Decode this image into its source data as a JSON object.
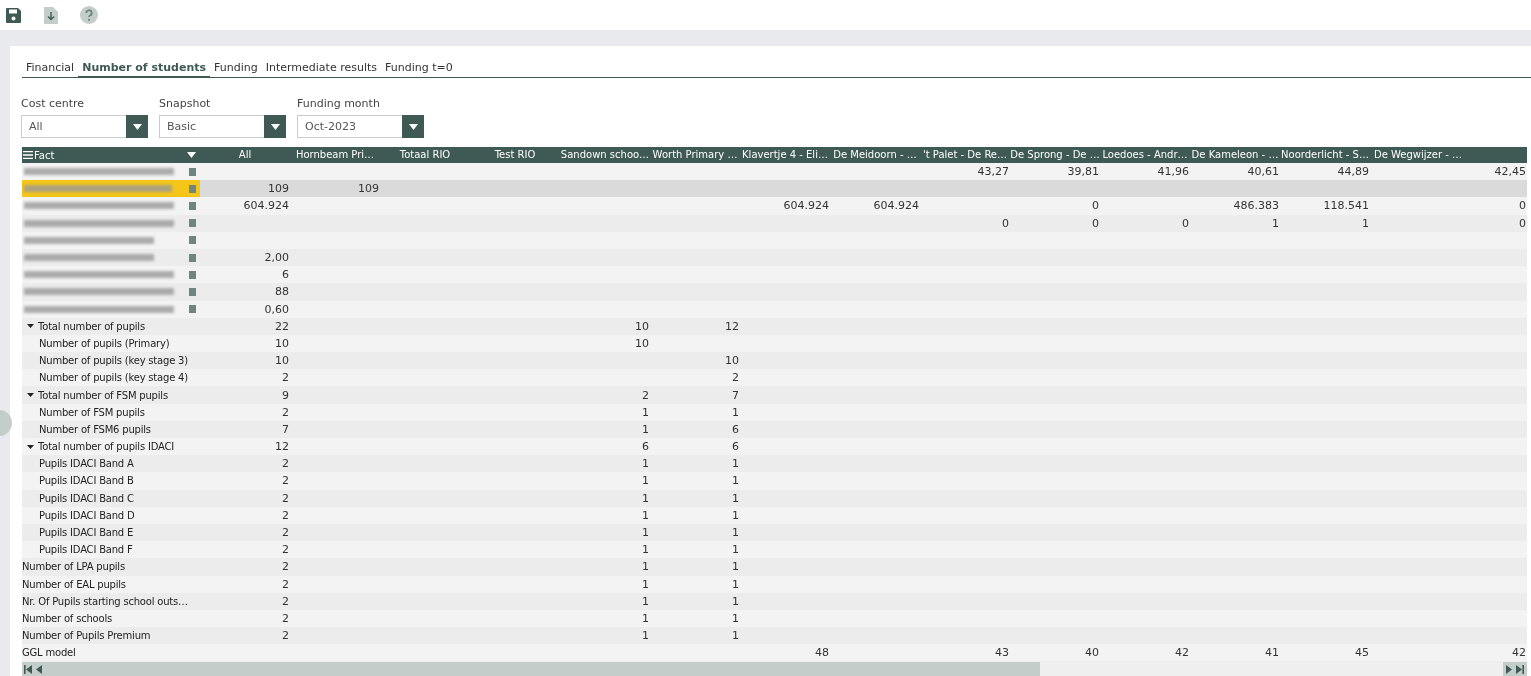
{
  "tabs": [
    {
      "label": "Financial",
      "selected": false
    },
    {
      "label": "Number of students",
      "selected": true
    },
    {
      "label": "Funding",
      "selected": false
    },
    {
      "label": "Intermediate results",
      "selected": false
    },
    {
      "label": "Funding t=0",
      "selected": false
    }
  ],
  "filters": [
    {
      "label": "Cost centre",
      "value": "All"
    },
    {
      "label": "Snapshot",
      "value": "Basic"
    },
    {
      "label": "Funding month",
      "value": "Oct-2023"
    }
  ],
  "table": {
    "columns": [
      "Fact",
      "All",
      "Hornbeam Pri…",
      "Totaal RIO",
      "Test RIO",
      "Sandown schoo…",
      "Worth Primary …",
      "Klavertje 4 - Eli…",
      "De Meidoorn - …",
      "'t Palet - De Re…",
      "De Sprong - De …",
      "Loedoes - Andr…",
      "De Kameleon - …",
      "Noorderlicht - S…",
      "De Wegwijzer - …"
    ],
    "rows": [
      {
        "kind": "blurred",
        "selected": false,
        "values": {
          "c8": "43,27",
          "c9": "39,81",
          "c10": "41,96",
          "c11": "40,61",
          "c12": "44,89",
          "c13": "42,45"
        }
      },
      {
        "kind": "blurred",
        "selected": true,
        "values": {
          "c0": "109",
          "c1": "109"
        }
      },
      {
        "kind": "blurred",
        "selected": false,
        "values": {
          "c0": "604.924",
          "c6": "604.924",
          "c7": "604.924",
          "c9": "0",
          "c11": "486.383",
          "c12": "118.541",
          "c13": "0"
        }
      },
      {
        "kind": "blurred",
        "selected": false,
        "values": {
          "c8": "0",
          "c9": "0",
          "c10": "0",
          "c11": "1",
          "c12": "1",
          "c13": "0"
        }
      },
      {
        "kind": "blurred",
        "selected": false
      },
      {
        "kind": "blurred",
        "selected": false,
        "values": {
          "c0": "2,00"
        }
      },
      {
        "kind": "blurred",
        "selected": false,
        "values": {
          "c0": "6"
        }
      },
      {
        "kind": "blurred",
        "selected": false,
        "values": {
          "c0": "88"
        }
      },
      {
        "kind": "blurred",
        "selected": false,
        "values": {
          "c0": "0,60"
        }
      },
      {
        "kind": "group",
        "label": "Total number of pupils",
        "expanded": true,
        "values": {
          "c0": "22",
          "c4": "10",
          "c5": "12"
        },
        "children": [
          {
            "kind": "item",
            "label": "Number of pupils (Primary)",
            "values": {
              "c0": "10",
              "c4": "10"
            }
          },
          {
            "kind": "item",
            "label": "Number of pupils (key stage 3)",
            "values": {
              "c0": "10",
              "c5": "10"
            }
          },
          {
            "kind": "item",
            "label": "Number of pupils (key stage 4)",
            "values": {
              "c0": "2",
              "c5": "2"
            }
          }
        ]
      },
      {
        "kind": "group",
        "label": "Total number of FSM pupils",
        "expanded": true,
        "values": {
          "c0": "9",
          "c4": "2",
          "c5": "7"
        },
        "children": [
          {
            "kind": "item",
            "label": "Number of FSM pupils",
            "values": {
              "c0": "2",
              "c4": "1",
              "c5": "1"
            }
          },
          {
            "kind": "item",
            "label": "Number of FSM6 pupils",
            "values": {
              "c0": "7",
              "c4": "1",
              "c5": "6"
            }
          }
        ]
      },
      {
        "kind": "group",
        "label": "Total number of pupils IDACI",
        "expanded": true,
        "values": {
          "c0": "12",
          "c4": "6",
          "c5": "6"
        },
        "children": [
          {
            "kind": "item",
            "label": "Pupils IDACI Band A",
            "values": {
              "c0": "2",
              "c4": "1",
              "c5": "1"
            }
          },
          {
            "kind": "item",
            "label": "Pupils IDACI Band B",
            "values": {
              "c0": "2",
              "c4": "1",
              "c5": "1"
            }
          },
          {
            "kind": "item",
            "label": "Pupils IDACI Band C",
            "values": {
              "c0": "2",
              "c4": "1",
              "c5": "1"
            }
          },
          {
            "kind": "item",
            "label": "Pupils IDACI Band D",
            "values": {
              "c0": "2",
              "c4": "1",
              "c5": "1"
            }
          },
          {
            "kind": "item",
            "label": "Pupils IDACI Band E",
            "values": {
              "c0": "2",
              "c4": "1",
              "c5": "1"
            }
          },
          {
            "kind": "item",
            "label": "Pupils IDACI Band F",
            "values": {
              "c0": "2",
              "c4": "1",
              "c5": "1"
            }
          }
        ]
      },
      {
        "kind": "item",
        "label": "Number of LPA pupils",
        "values": {
          "c0": "2",
          "c4": "1",
          "c5": "1"
        }
      },
      {
        "kind": "item",
        "label": "Number of EAL pupils",
        "values": {
          "c0": "2",
          "c4": "1",
          "c5": "1"
        }
      },
      {
        "kind": "item",
        "label": "Nr. Of Pupils starting school outs…",
        "values": {
          "c0": "2",
          "c4": "1",
          "c5": "1"
        }
      },
      {
        "kind": "item",
        "label": "Number of schools",
        "values": {
          "c0": "2",
          "c4": "1",
          "c5": "1"
        }
      },
      {
        "kind": "item",
        "label": "Number of Pupils Premium",
        "values": {
          "c0": "2",
          "c4": "1",
          "c5": "1"
        }
      },
      {
        "kind": "item",
        "label": "GGL model",
        "values": {
          "c6": "48",
          "c8": "43",
          "c9": "40",
          "c10": "42",
          "c11": "41",
          "c12": "45",
          "c13": "42"
        }
      }
    ]
  }
}
